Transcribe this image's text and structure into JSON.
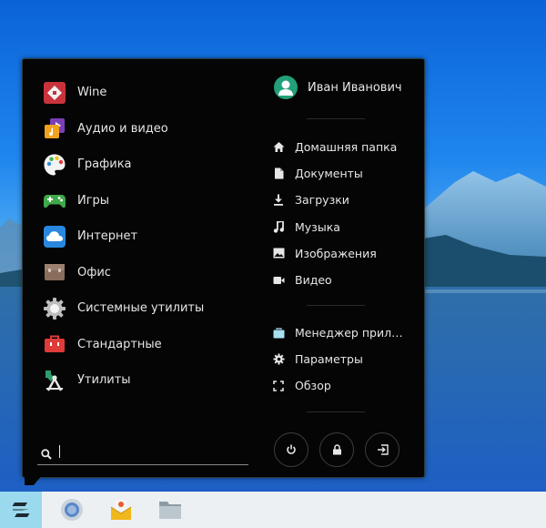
{
  "user": {
    "name": "Иван Иванович"
  },
  "categories": [
    {
      "label": "Wine",
      "icon": "wine-icon"
    },
    {
      "label": "Аудио и видео",
      "icon": "multimedia-icon"
    },
    {
      "label": "Графика",
      "icon": "palette-icon"
    },
    {
      "label": "Игры",
      "icon": "gamepad-icon"
    },
    {
      "label": "Интернет",
      "icon": "cloud-icon"
    },
    {
      "label": "Офис",
      "icon": "briefcase-icon"
    },
    {
      "label": "Системные утилиты",
      "icon": "gear-icon"
    },
    {
      "label": "Стандартные",
      "icon": "toolbox-icon"
    },
    {
      "label": "Утилиты",
      "icon": "utilities-icon"
    }
  ],
  "search": {
    "value": "",
    "placeholder": ""
  },
  "places": [
    {
      "label": "Домашняя папка",
      "icon": "home-icon"
    },
    {
      "label": "Документы",
      "icon": "document-icon"
    },
    {
      "label": "Загрузки",
      "icon": "download-icon"
    },
    {
      "label": "Музыка",
      "icon": "music-icon"
    },
    {
      "label": "Изображения",
      "icon": "image-icon"
    },
    {
      "label": "Видео",
      "icon": "video-icon"
    }
  ],
  "tools": [
    {
      "label": "Менеджер прило...",
      "icon": "app-manager-icon"
    },
    {
      "label": "Параметры",
      "icon": "settings-icon"
    },
    {
      "label": "Обзор",
      "icon": "overview-icon"
    }
  ],
  "session_buttons": [
    "power-icon",
    "lock-icon",
    "logout-icon"
  ],
  "taskbar": [
    "zorin-logo-icon",
    "browser-icon",
    "mail-icon",
    "files-icon"
  ],
  "colors": {
    "menu_bg": "#050505",
    "accent": "#9bd9ee",
    "avatar": "#22a07a",
    "text": "#e6e6e6"
  }
}
